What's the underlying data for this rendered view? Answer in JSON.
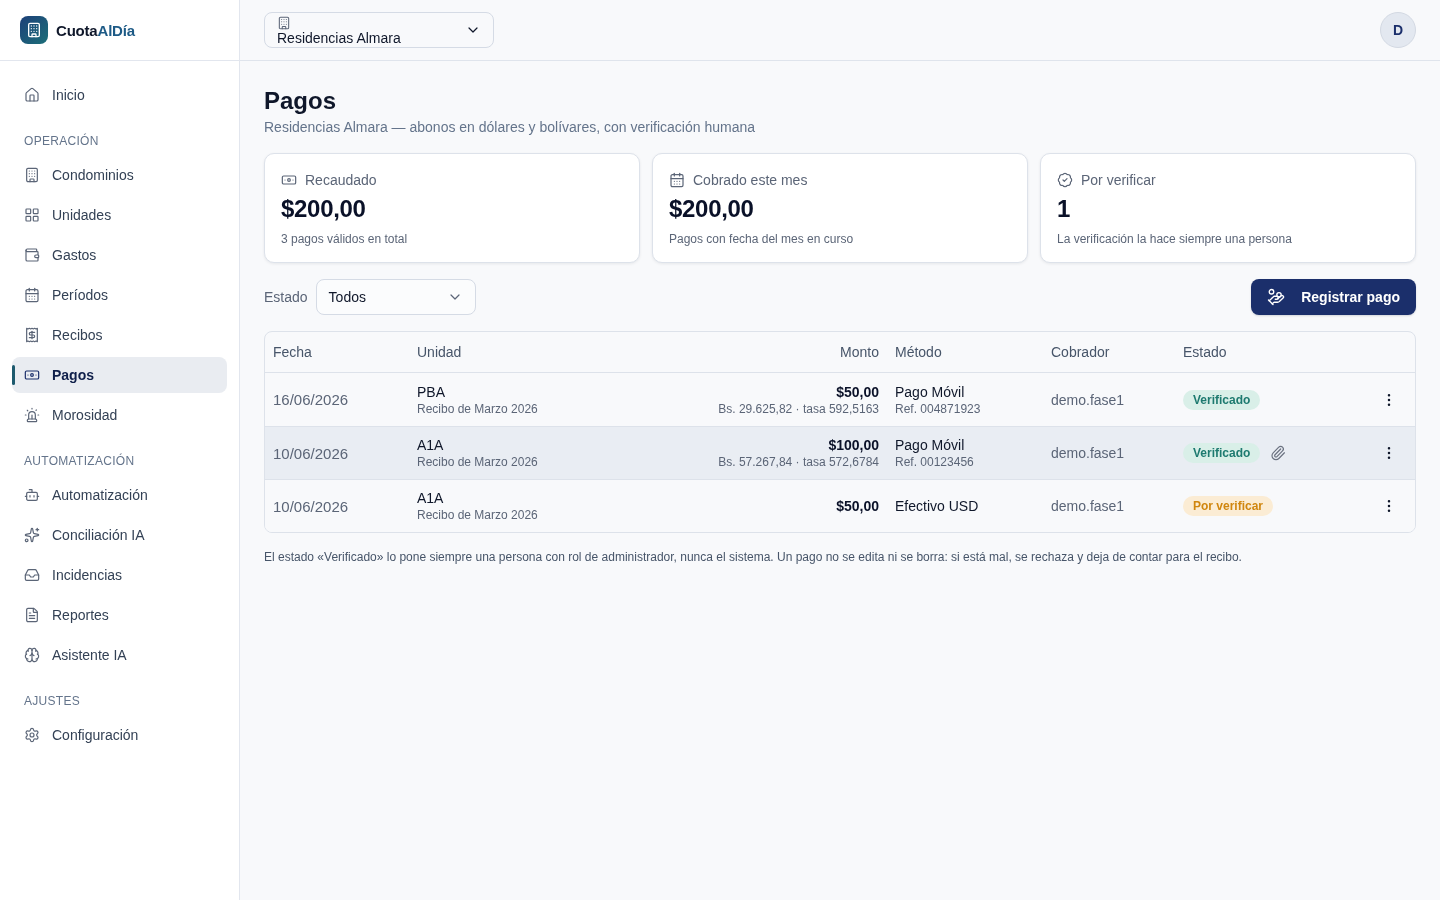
{
  "sidebar": {
    "brand": {
      "name": "Cuota",
      "accent": "AlDía"
    },
    "sections": [
      {
        "items": [
          {
            "label": "Inicio",
            "selected": false
          }
        ]
      },
      {
        "heading": "OPERACIÓN",
        "items": [
          {
            "label": "Condominios",
            "selected": false
          },
          {
            "label": "Unidades",
            "selected": false
          },
          {
            "label": "Gastos",
            "selected": false
          },
          {
            "label": "Períodos",
            "selected": false
          },
          {
            "label": "Recibos",
            "selected": false
          },
          {
            "label": "Pagos",
            "selected": true
          },
          {
            "label": "Morosidad",
            "selected": false
          }
        ]
      },
      {
        "heading": "AUTOMATIZACIÓN",
        "items": [
          {
            "label": "Automatización",
            "selected": false
          },
          {
            "label": "Conciliación IA",
            "selected": false
          },
          {
            "label": "Incidencias",
            "selected": false
          },
          {
            "label": "Reportes",
            "selected": false
          },
          {
            "label": "Asistente IA",
            "selected": false
          }
        ]
      },
      {
        "heading": "AJUSTES",
        "items": [
          {
            "label": "Configuración",
            "selected": false
          }
        ]
      }
    ]
  },
  "header": {
    "condominium_select": {
      "value": "Residencias Almara"
    },
    "avatar": {
      "initial": "D"
    }
  },
  "page": {
    "title": "Pagos",
    "subtitle": "Residencias Almara — abonos en dólares y bolívares, con verificación humana"
  },
  "stats": [
    {
      "label": "Recaudado",
      "value": "$200,00",
      "caption": "3 pagos válidos en total"
    },
    {
      "label": "Cobrado este mes",
      "value": "$200,00",
      "caption": "Pagos con fecha del mes en curso"
    },
    {
      "label": "Por verificar",
      "value": "1",
      "caption": "La verificación la hace siempre una persona"
    }
  ],
  "filter": {
    "label": "Estado",
    "value": "Todos"
  },
  "register_button": {
    "label": "Registrar pago"
  },
  "table": {
    "columns": [
      "Fecha",
      "Unidad",
      "Monto",
      "Método",
      "Cobrador",
      "Estado"
    ],
    "rows": [
      {
        "date": "16/06/2026",
        "unit": "PBA",
        "receipt": "Recibo de Marzo 2026",
        "amount": "$50,00",
        "amount_detail": "Bs. 29.625,82 · tasa 592,5163",
        "method": "Pago Móvil",
        "reference": "Ref. 004871923",
        "collector": "demo.fase1",
        "status": {
          "label": "Verificado",
          "kind": "verified"
        },
        "attachment": false,
        "highlighted": false
      },
      {
        "date": "10/06/2026",
        "unit": "A1A",
        "receipt": "Recibo de Marzo 2026",
        "amount": "$100,00",
        "amount_detail": "Bs. 57.267,84 · tasa 572,6784",
        "method": "Pago Móvil",
        "reference": "Ref. 00123456",
        "collector": "demo.fase1",
        "status": {
          "label": "Verificado",
          "kind": "verified"
        },
        "attachment": true,
        "highlighted": true
      },
      {
        "date": "10/06/2026",
        "unit": "A1A",
        "receipt": "Recibo de Marzo 2026",
        "amount": "$50,00",
        "method": "Efectivo USD",
        "collector": "demo.fase1",
        "status": {
          "label": "Por verificar",
          "kind": "pending"
        },
        "attachment": false,
        "highlighted": false
      }
    ]
  },
  "note": "El estado «Verificado» lo pone siempre una persona con rol de administrador, nunca el sistema. Un pago no se edita ni se borra: si está mal, se rechaza y deja de contar para el recibo."
}
